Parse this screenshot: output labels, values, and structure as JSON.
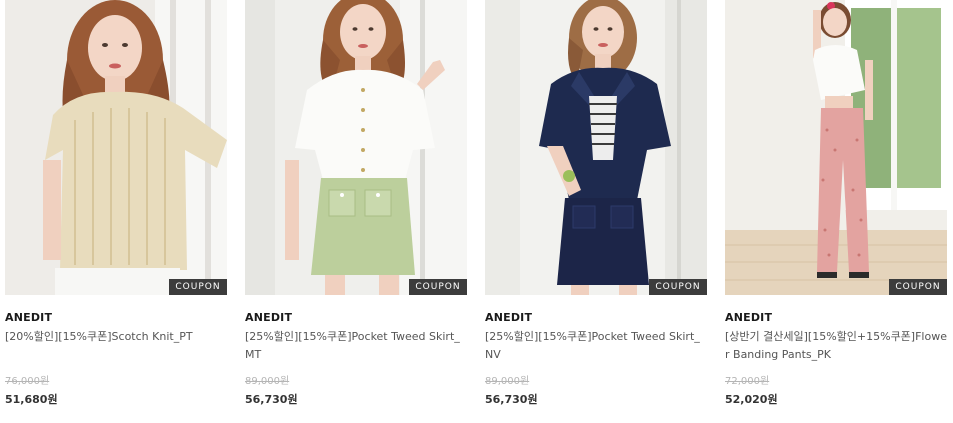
{
  "coupon_label": "COUPON",
  "products": [
    {
      "brand": "ANEDIT",
      "name": "[20%할인][15%쿠폰]Scotch Knit_PT",
      "original_price": "76,000원",
      "sale_price": "51,680원",
      "image": "woman in beige crochet knit top and white pants"
    },
    {
      "brand": "ANEDIT",
      "name": "[25%할인][15%쿠폰]Pocket Tweed Skirt_MT",
      "original_price": "89,000원",
      "sale_price": "56,730원",
      "image": "woman in white blouse and mint tweed skirt"
    },
    {
      "brand": "ANEDIT",
      "name": "[25%할인][15%쿠폰]Pocket Tweed Skirt_NV",
      "original_price": "89,000원",
      "sale_price": "56,730원",
      "image": "woman in navy tweed jacket and navy skirt"
    },
    {
      "brand": "ANEDIT",
      "name": "[상반기 결산세일][15%할인+15%쿠폰]Flower Banding Pants_PK",
      "original_price": "72,000원",
      "sale_price": "52,020원",
      "image": "woman in white top and pink floral banding pants"
    }
  ]
}
